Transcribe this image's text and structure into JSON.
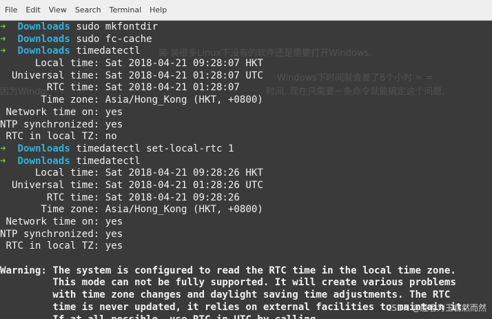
{
  "menu": [
    "File",
    "Edit",
    "View",
    "Search",
    "Terminal",
    "Help"
  ],
  "prompt": {
    "arrow": "➜",
    "dir": "Downloads"
  },
  "lines": [
    {
      "type": "cmd",
      "text": "sudo mkfontdir"
    },
    {
      "type": "cmd",
      "text": "sudo fc-cache"
    },
    {
      "type": "cmd",
      "text": "timedatectl"
    },
    {
      "type": "out",
      "text": "      Local time: Sat 2018-04-21 09:28:07 HKT"
    },
    {
      "type": "out",
      "text": "  Universal time: Sat 2018-04-21 01:28:07 UTC"
    },
    {
      "type": "out",
      "text": "        RTC time: Sat 2018-04-21 01:28:07"
    },
    {
      "type": "out",
      "text": "       Time zone: Asia/Hong_Kong (HKT, +0800)"
    },
    {
      "type": "out",
      "text": " Network time on: yes"
    },
    {
      "type": "out",
      "text": "NTP synchronized: yes"
    },
    {
      "type": "out",
      "text": " RTC in local TZ: no"
    },
    {
      "type": "cmd",
      "text": "timedatectl set-local-rtc 1"
    },
    {
      "type": "cmd",
      "text": "timedatectl"
    },
    {
      "type": "out",
      "text": "      Local time: Sat 2018-04-21 09:28:26 HKT"
    },
    {
      "type": "out",
      "text": "  Universal time: Sat 2018-04-21 01:28:26 UTC"
    },
    {
      "type": "out",
      "text": "        RTC time: Sat 2018-04-21 09:28:26"
    },
    {
      "type": "out",
      "text": "       Time zone: Asia/Hong_Kong (HKT, +0800)"
    },
    {
      "type": "out",
      "text": " Network time on: yes"
    },
    {
      "type": "out",
      "text": "NTP synchronized: yes"
    },
    {
      "type": "out",
      "text": " RTC in local TZ: yes"
    },
    {
      "type": "out",
      "text": ""
    },
    {
      "type": "warn",
      "label": "Warning:",
      "text": " The system is configured to read the RTC time in the local time zone."
    },
    {
      "type": "bold",
      "text": "         This mode can not be fully supported. It will create various problems"
    },
    {
      "type": "bold",
      "text": "         with time zone changes and daylight saving time adjustments. The RTC"
    },
    {
      "type": "bold",
      "text": "         time is never updated, it relies on external facilities to maintain it."
    },
    {
      "type": "bold",
      "text": "         If at all possible, use RTC in UTC by calling"
    }
  ],
  "watermark": {
    "bg_text_1": "装 装很多Linux下没有的软件还是需要打开Windows.",
    "bg_text_2": "Windows下时间就会差了8个小时 = =",
    "bg_text_3": "因为Windo",
    "bg_text_4": "时间, 现在只需要一条命令就能搞定这个问题.",
    "csdn": "CSDN @胜者为王自然而然"
  }
}
